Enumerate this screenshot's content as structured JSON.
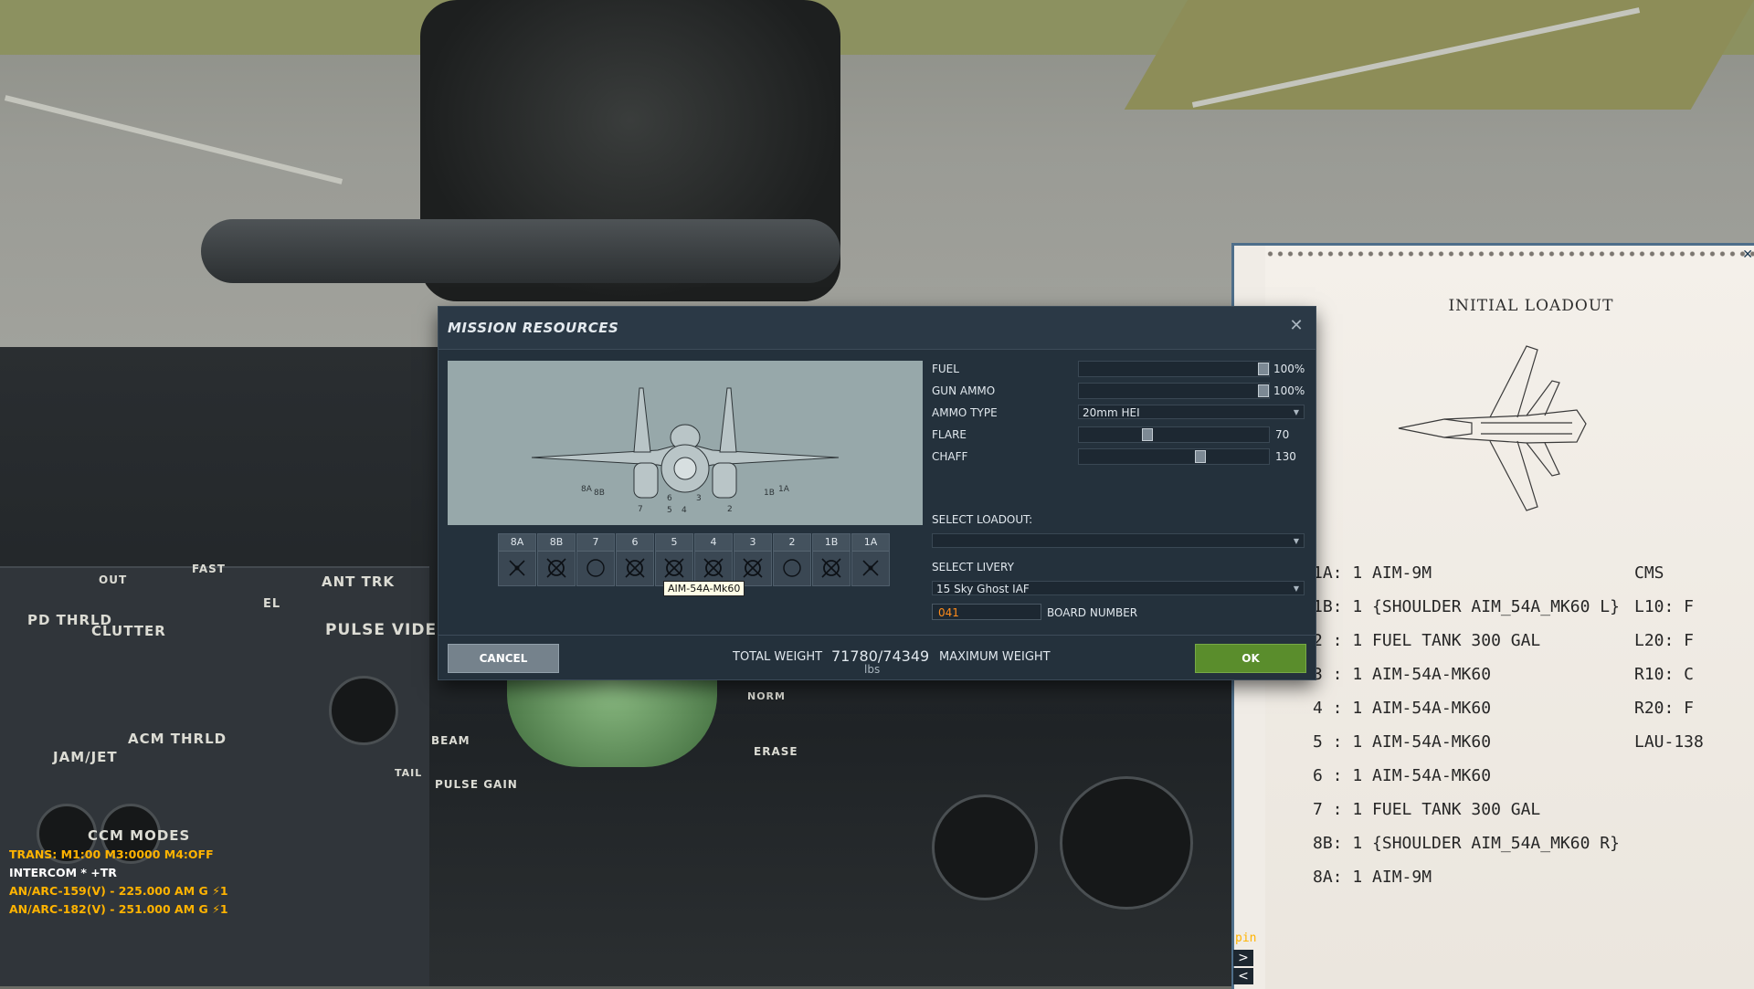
{
  "cockpit": {
    "labels": [
      "ANT TRK",
      "PULSE VIDEO",
      "PD THRLD",
      "CLUTTER",
      "JAM/JET",
      "ACM THRLD",
      "CCM MODES",
      "BEAM",
      "PULSE GAIN",
      "ERASE",
      "NORM",
      "TAIL",
      "FAST",
      "OUT",
      "EL"
    ]
  },
  "radio": {
    "trans": "TRANS: M1:00 M3:0000 M4:OFF",
    "intercom": "INTERCOM  * +TR",
    "arc159": "AN/ARC-159(V) - 225.000 AM G ⚡1",
    "arc182": "AN/ARC-182(V) - 251.000 AM G ⚡1"
  },
  "kneeboard": {
    "title": "INITIAL LOADOUT",
    "close": "✕",
    "pin": "pin",
    "next": ">",
    "prev": "<",
    "lines": [
      {
        "left": "1A: 1 AIM-9M",
        "right": "CMS"
      },
      {
        "left": "1B: 1 {SHOULDER AIM_54A_MK60 L}",
        "right": "L10: F"
      },
      {
        "left": "2 : 1 FUEL TANK 300 GAL",
        "right": "L20: F"
      },
      {
        "left": "3 : 1 AIM-54A-MK60",
        "right": "R10: C"
      },
      {
        "left": "4 : 1 AIM-54A-MK60",
        "right": "R20: F"
      },
      {
        "left": "5 : 1 AIM-54A-MK60",
        "right": "LAU-138"
      },
      {
        "left": "6 : 1 AIM-54A-MK60",
        "right": ""
      },
      {
        "left": "7 : 1 FUEL TANK 300 GAL",
        "right": ""
      },
      {
        "left": "8B: 1 {SHOULDER AIM_54A_MK60 R}",
        "right": ""
      },
      {
        "left": "8A: 1 AIM-9M",
        "right": ""
      }
    ]
  },
  "dialog": {
    "title": "MISSION RESOURCES",
    "close": "✕",
    "fuel": {
      "label": "FUEL",
      "value": "100%",
      "level": 1.0
    },
    "gun_ammo": {
      "label": "GUN AMMO",
      "value": "100%",
      "level": 1.0
    },
    "ammo_type": {
      "label": "AMMO TYPE",
      "value": "20mm HEI"
    },
    "flare": {
      "label": "FLARE",
      "value": "70",
      "level": 0.35
    },
    "chaff": {
      "label": "CHAFF",
      "value": "130",
      "level": 0.65
    },
    "select_loadout": {
      "label": "SELECT LOADOUT:",
      "value": ""
    },
    "select_livery": {
      "label": "SELECT LIVERY",
      "value": "15 Sky Ghost IAF"
    },
    "board_number": {
      "label": "BOARD NUMBER",
      "value": "041"
    },
    "preview_labels": {
      "p8a": "8A",
      "p8b": "8B",
      "p7": "7",
      "p6": "6",
      "p5": "5",
      "p4": "4",
      "p3": "3",
      "p2": "2",
      "p1b": "1B",
      "p1a": "1A"
    },
    "pylons": [
      "8A",
      "8B",
      "7",
      "6",
      "5",
      "4",
      "3",
      "2",
      "1B",
      "1A"
    ],
    "tooltip": "AIM-54A-Mk60",
    "cancel": "CANCEL",
    "ok": "OK",
    "total_weight_label": "TOTAL WEIGHT",
    "total_weight_value": "71780/74349",
    "weight_unit": "lbs",
    "max_weight_label": "MAXIMUM WEIGHT"
  }
}
